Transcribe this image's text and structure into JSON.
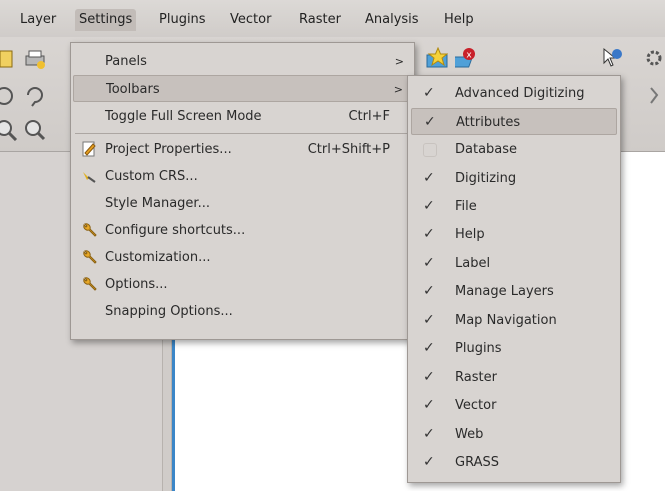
{
  "menubar": {
    "items": [
      {
        "label": "Layer"
      },
      {
        "label": "Settings"
      },
      {
        "label": "Plugins"
      },
      {
        "label": "Vector"
      },
      {
        "label": "Raster"
      },
      {
        "label": "Analysis"
      },
      {
        "label": "Help"
      }
    ]
  },
  "settings_menu": {
    "items": [
      {
        "label": "Panels",
        "shortcut": "",
        "arrow": ">"
      },
      {
        "label": "Toolbars",
        "shortcut": "",
        "arrow": ">"
      },
      {
        "label": "Toggle Full Screen Mode",
        "shortcut": "Ctrl+F"
      },
      {
        "label": "Project Properties...",
        "shortcut": "Ctrl+Shift+P"
      },
      {
        "label": "Custom CRS...",
        "shortcut": ""
      },
      {
        "label": "Style Manager...",
        "shortcut": ""
      },
      {
        "label": "Configure shortcuts...",
        "shortcut": ""
      },
      {
        "label": "Customization...",
        "shortcut": ""
      },
      {
        "label": "Options...",
        "shortcut": ""
      },
      {
        "label": "Snapping Options...",
        "shortcut": ""
      }
    ]
  },
  "toolbars_menu": {
    "items": [
      {
        "label": "Advanced Digitizing",
        "checked": true
      },
      {
        "label": "Attributes",
        "checked": true
      },
      {
        "label": "Database",
        "checked": false
      },
      {
        "label": "Digitizing",
        "checked": true
      },
      {
        "label": "File",
        "checked": true
      },
      {
        "label": "Help",
        "checked": true
      },
      {
        "label": "Label",
        "checked": true
      },
      {
        "label": "Manage Layers",
        "checked": true
      },
      {
        "label": "Map Navigation",
        "checked": true
      },
      {
        "label": "Plugins",
        "checked": true
      },
      {
        "label": "Raster",
        "checked": true
      },
      {
        "label": "Vector",
        "checked": true
      },
      {
        "label": "Web",
        "checked": true
      },
      {
        "label": "GRASS",
        "checked": true
      }
    ],
    "check_glyph": "✓"
  }
}
